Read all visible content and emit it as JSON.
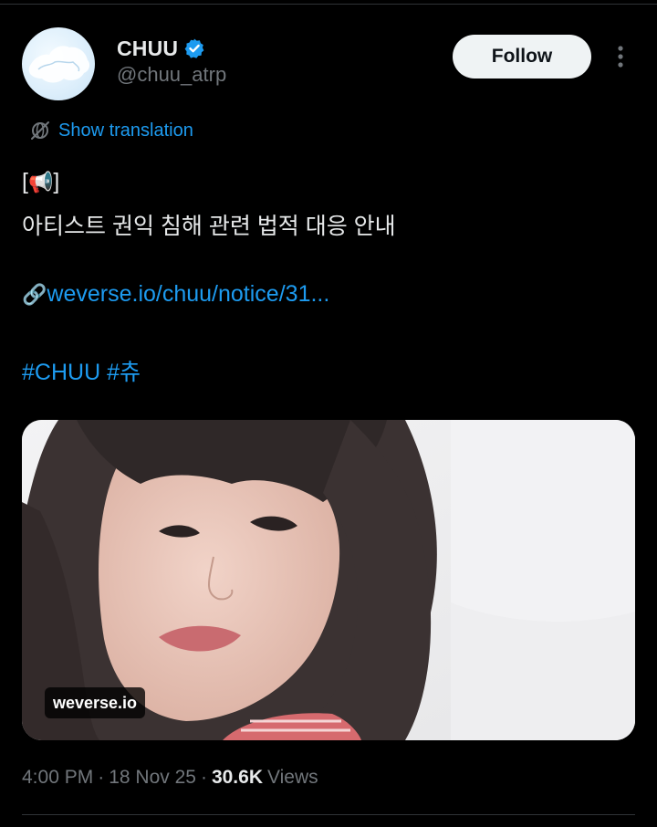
{
  "author": {
    "display_name": "CHUU",
    "handle": "@chuu_atrp",
    "verified": true
  },
  "actions": {
    "follow_label": "Follow",
    "more_icon": "more-vertical-icon"
  },
  "translation": {
    "label": "Show translation",
    "icon": "translate-globe-icon"
  },
  "tweet": {
    "line1_open": "[",
    "line1_emoji": "📢",
    "line1_close": "]",
    "line2": "아티스트 권익 침해 관련 법적 대응 안내",
    "link_emoji": "🔗",
    "link_text": "weverse.io/chuu/notice/31...",
    "hashtags": [
      "#CHUU",
      "#츄"
    ]
  },
  "media": {
    "badge": "weverse.io"
  },
  "meta": {
    "time": "4:00 PM",
    "separator": "·",
    "date": "18 Nov 25",
    "views_count": "30.6K",
    "views_label": "Views"
  },
  "colors": {
    "background": "#000000",
    "text": "#e7e9ea",
    "secondary": "#71767b",
    "accent": "#1d9bf0",
    "follow_bg": "#eff3f4",
    "divider": "#2f3336"
  }
}
